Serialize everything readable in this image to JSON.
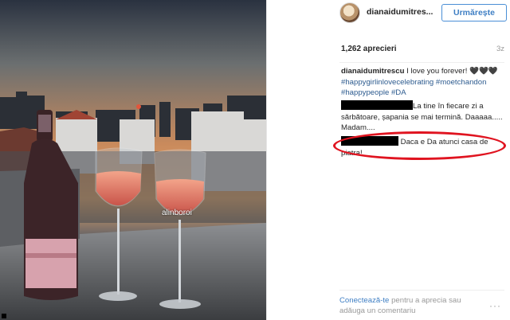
{
  "photo": {
    "watermark": "alinboroi"
  },
  "post": {
    "username": "dianaidumitres...",
    "follow_label": "Urmărește",
    "likes": "1,262 aprecieri",
    "age": "3z",
    "caption_user": "dianaidumitrescu",
    "caption_text": " I love you forever! 🖤🖤🖤",
    "hashtags": "#happygirlinlovecelebrating #moetchandon #happypeople #DA"
  },
  "comments": [
    {
      "text": "La tine în fiecare zi a sărbătoare, șapania se mai termină. Daaaaa..... Madam...."
    },
    {
      "text": " Daca e Da atunci casa de piatra!"
    }
  ],
  "footer": {
    "login_link": "Conectează-te",
    "login_rest": " pentru a aprecia sau adăuga un comentariu",
    "more": "···"
  },
  "colors": {
    "accent": "#3f7fc4",
    "highlight": "#e01420"
  }
}
